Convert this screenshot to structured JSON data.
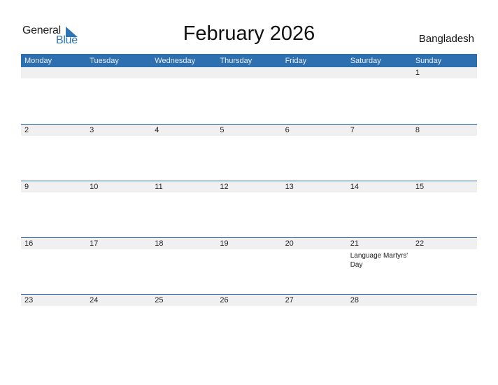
{
  "logo": {
    "line1": "General",
    "line2": "Blue",
    "icon": "triangle-flag-icon"
  },
  "title": "February 2026",
  "country": "Bangladesh",
  "colors": {
    "header": "#2e6fb0",
    "band": "#f0f0f0",
    "logo_blue": "#2e75b6"
  },
  "weekdays": [
    "Monday",
    "Tuesday",
    "Wednesday",
    "Thursday",
    "Friday",
    "Saturday",
    "Sunday"
  ],
  "weeks": [
    {
      "days": [
        "",
        "",
        "",
        "",
        "",
        "",
        "1"
      ],
      "events": [
        "",
        "",
        "",
        "",
        "",
        "",
        ""
      ]
    },
    {
      "days": [
        "2",
        "3",
        "4",
        "5",
        "6",
        "7",
        "8"
      ],
      "events": [
        "",
        "",
        "",
        "",
        "",
        "",
        ""
      ]
    },
    {
      "days": [
        "9",
        "10",
        "11",
        "12",
        "13",
        "14",
        "15"
      ],
      "events": [
        "",
        "",
        "",
        "",
        "",
        "",
        ""
      ]
    },
    {
      "days": [
        "16",
        "17",
        "18",
        "19",
        "20",
        "21",
        "22"
      ],
      "events": [
        "",
        "",
        "",
        "",
        "",
        "Language Martyrs' Day",
        ""
      ]
    },
    {
      "days": [
        "23",
        "24",
        "25",
        "26",
        "27",
        "28",
        ""
      ],
      "events": [
        "",
        "",
        "",
        "",
        "",
        "",
        ""
      ]
    }
  ]
}
